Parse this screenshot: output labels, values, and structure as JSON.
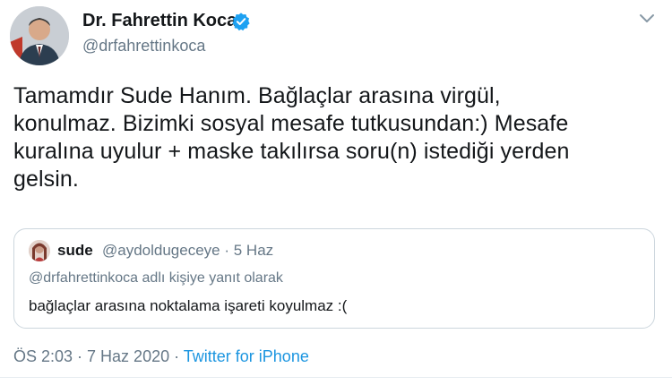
{
  "author": {
    "display_name": "Dr. Fahrettin Koca",
    "handle": "@drfahrettinkoca",
    "verified_icon": "verified-badge-icon",
    "verified_color": "#1da1f2"
  },
  "menu_icon": "chevron-down-icon",
  "tweet_lines": [
    "Tamamdır Sude Hanım. Bağlaçlar arasına virgül,",
    "konulmaz. Bizimki sosyal mesafe tutkusundan:) Mesafe",
    "kuralına uyulur + maske takılırsa soru(n) istediği yerden",
    "gelsin."
  ],
  "quote": {
    "name": "sude",
    "meta": "@aydoldugeceye · 5 Haz",
    "reply_to": "@drfahrettinkoca adlı kişiye yanıt olarak",
    "text": "bağlaçlar arasına noktalama işareti koyulmaz :("
  },
  "footer": {
    "time_date": "ÖS 2:03 · 7 Haz 2020 · ",
    "source": "Twitter for iPhone"
  },
  "colors": {
    "link": "#1b95e0",
    "secondary_text": "#657786",
    "border": "#ccd6dd"
  }
}
